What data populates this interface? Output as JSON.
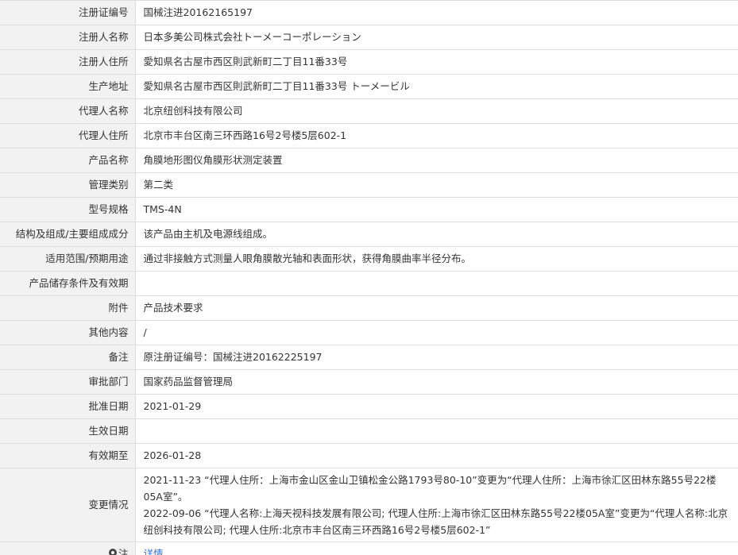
{
  "rows": [
    {
      "label": "注册证编号",
      "value": "国械注进20162165197"
    },
    {
      "label": "注册人名称",
      "value": "日本多美公司株式会社トーメーコーポレーション"
    },
    {
      "label": "注册人住所",
      "value": "愛知県名古屋市西区則武新町二丁目11番33号"
    },
    {
      "label": "生产地址",
      "value": "愛知県名古屋市西区則武新町二丁目11番33号 トーメービル"
    },
    {
      "label": "代理人名称",
      "value": "北京纽创科技有限公司"
    },
    {
      "label": "代理人住所",
      "value": "北京市丰台区南三环西路16号2号楼5层602-1"
    },
    {
      "label": "产品名称",
      "value": "角膜地形图仪角膜形状测定装置"
    },
    {
      "label": "管理类别",
      "value": "第二类"
    },
    {
      "label": "型号规格",
      "value": "TMS-4N"
    },
    {
      "label": "结构及组成/主要组成成分",
      "value": "该产品由主机及电源线组成。"
    },
    {
      "label": "适用范围/预期用途",
      "value": "通过非接触方式测量人眼角膜散光轴和表面形状，获得角膜曲率半径分布。"
    },
    {
      "label": "产品储存条件及有效期",
      "value": ""
    },
    {
      "label": "附件",
      "value": "产品技术要求"
    },
    {
      "label": "其他内容",
      "value": "/"
    },
    {
      "label": "备注",
      "value": "原注册证编号：国械注进20162225197"
    },
    {
      "label": "审批部门",
      "value": "国家药品监督管理局"
    },
    {
      "label": "批准日期",
      "value": "2021-01-29"
    },
    {
      "label": "生效日期",
      "value": ""
    },
    {
      "label": "有效期至",
      "value": "2026-01-28"
    }
  ],
  "changes": {
    "label": "变更情况",
    "line1": "2021-11-23 “代理人住所：上海市金山区金山卫镇松金公路1793号80-10”变更为“代理人住所：上海市徐汇区田林东路55号22楼05A室”。",
    "line2": "2022-09-06 “代理人名称:上海天视科技发展有限公司; 代理人住所:上海市徐汇区田林东路55号22楼05A室”变更为“代理人名称:北京纽创科技有限公司; 代理人住所:北京市丰台区南三环西路16号2号楼5层602-1”"
  },
  "footer": {
    "note_icon": "map-pin-icon",
    "note_label": "注",
    "details_link": "详情",
    "link_color": "#2a6fdb"
  }
}
